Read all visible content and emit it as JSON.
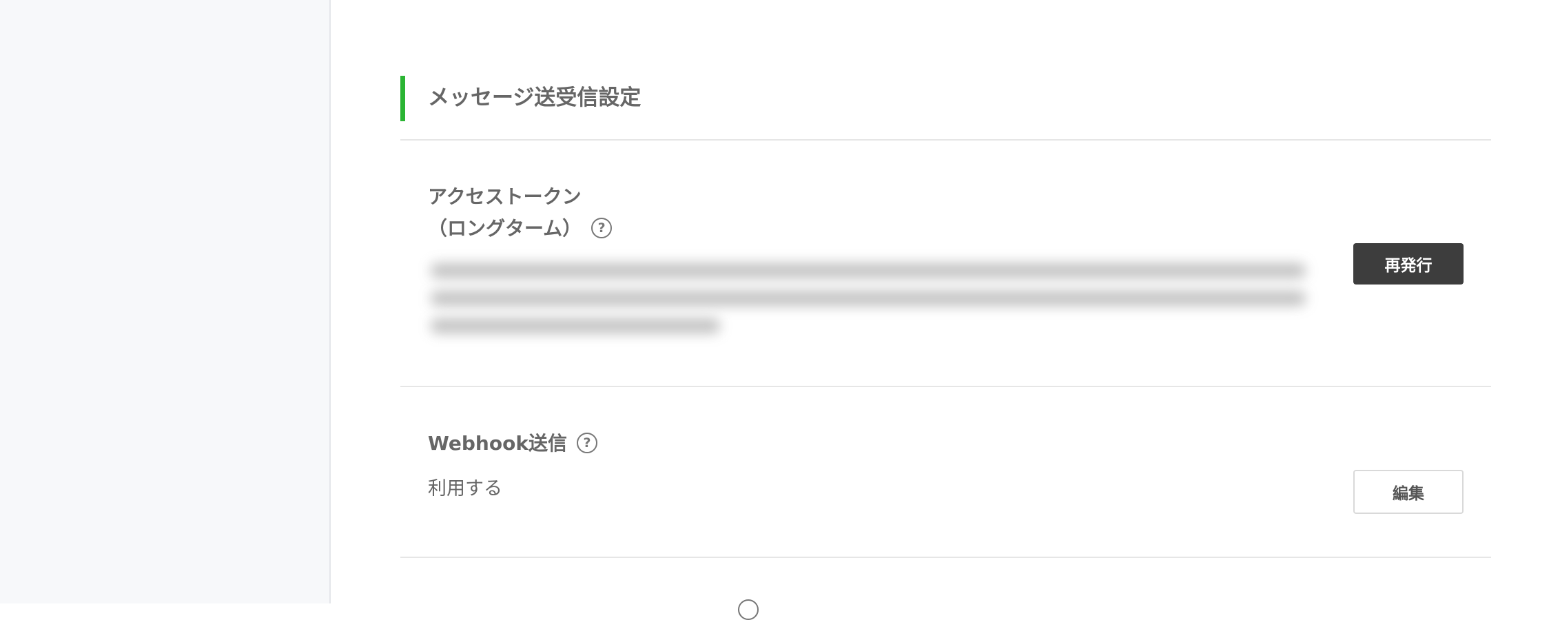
{
  "section": {
    "title": "メッセージ送受信設定",
    "accent_color": "#2bb534"
  },
  "access_token": {
    "label_line1": "アクセストークン",
    "label_line2": "（ロングターム）",
    "help_icon": "?",
    "reissue_button": "再発行"
  },
  "webhook": {
    "label": "Webhook送信",
    "help_icon": "?",
    "value": "利用する",
    "edit_button": "編集"
  }
}
